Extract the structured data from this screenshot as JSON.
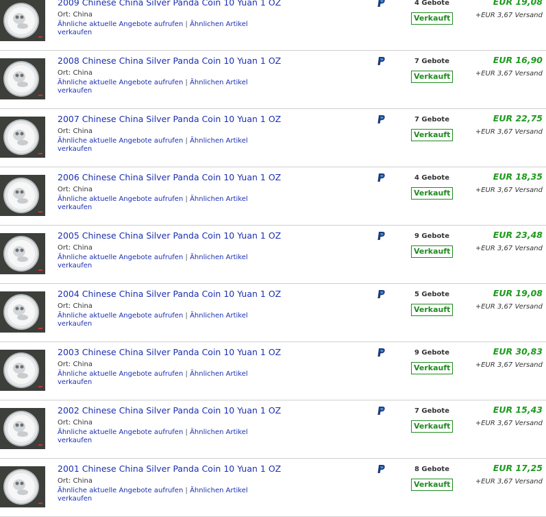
{
  "listings": [
    {
      "title": "2009 Chinese China Silver Panda Coin 10 Yuan 1 OZ",
      "bids": "4 Gebote",
      "price": "EUR 19,08"
    },
    {
      "title": "2008 Chinese China Silver Panda Coin 10 Yuan 1 OZ",
      "bids": "7 Gebote",
      "price": "EUR 16,90"
    },
    {
      "title": "2007 Chinese China Silver Panda Coin 10 Yuan 1 OZ",
      "bids": "7 Gebote",
      "price": "EUR 22,75"
    },
    {
      "title": "2006 Chinese China Silver Panda Coin 10 Yuan 1 OZ",
      "bids": "4 Gebote",
      "price": "EUR 18,35"
    },
    {
      "title": "2005 Chinese China Silver Panda Coin 10 Yuan 1 OZ",
      "bids": "9 Gebote",
      "price": "EUR 23,48"
    },
    {
      "title": "2004 Chinese China Silver Panda Coin 10 Yuan 1 OZ",
      "bids": "5 Gebote",
      "price": "EUR 19,08"
    },
    {
      "title": "2003 Chinese China Silver Panda Coin 10 Yuan 1 OZ",
      "bids": "9 Gebote",
      "price": "EUR 30,83"
    },
    {
      "title": "2002 Chinese China Silver Panda Coin 10 Yuan 1 OZ",
      "bids": "7 Gebote",
      "price": "EUR 15,43"
    },
    {
      "title": "2001 Chinese China Silver Panda Coin 10 Yuan 1 OZ",
      "bids": "8 Gebote",
      "price": "EUR 17,25"
    }
  ],
  "labels": {
    "location": "Ort: China",
    "similar_offers": "Ähnliche aktuelle Angebote aufrufen",
    "separator": "|",
    "similar_sell": "Ähnlichen Artikel verkaufen",
    "sold": "Verkauft",
    "shipping": "+EUR 3,67 Versand"
  },
  "icons": {
    "payment": "paypal-icon",
    "thumbnail": "silver-coin-thumbnail"
  },
  "colors": {
    "link": "#1a2fb0",
    "price": "#1e9a1e",
    "sold": "#1f8a1f",
    "paypal_dark": "#1f3a7a",
    "paypal_light": "#3b8fd6"
  }
}
